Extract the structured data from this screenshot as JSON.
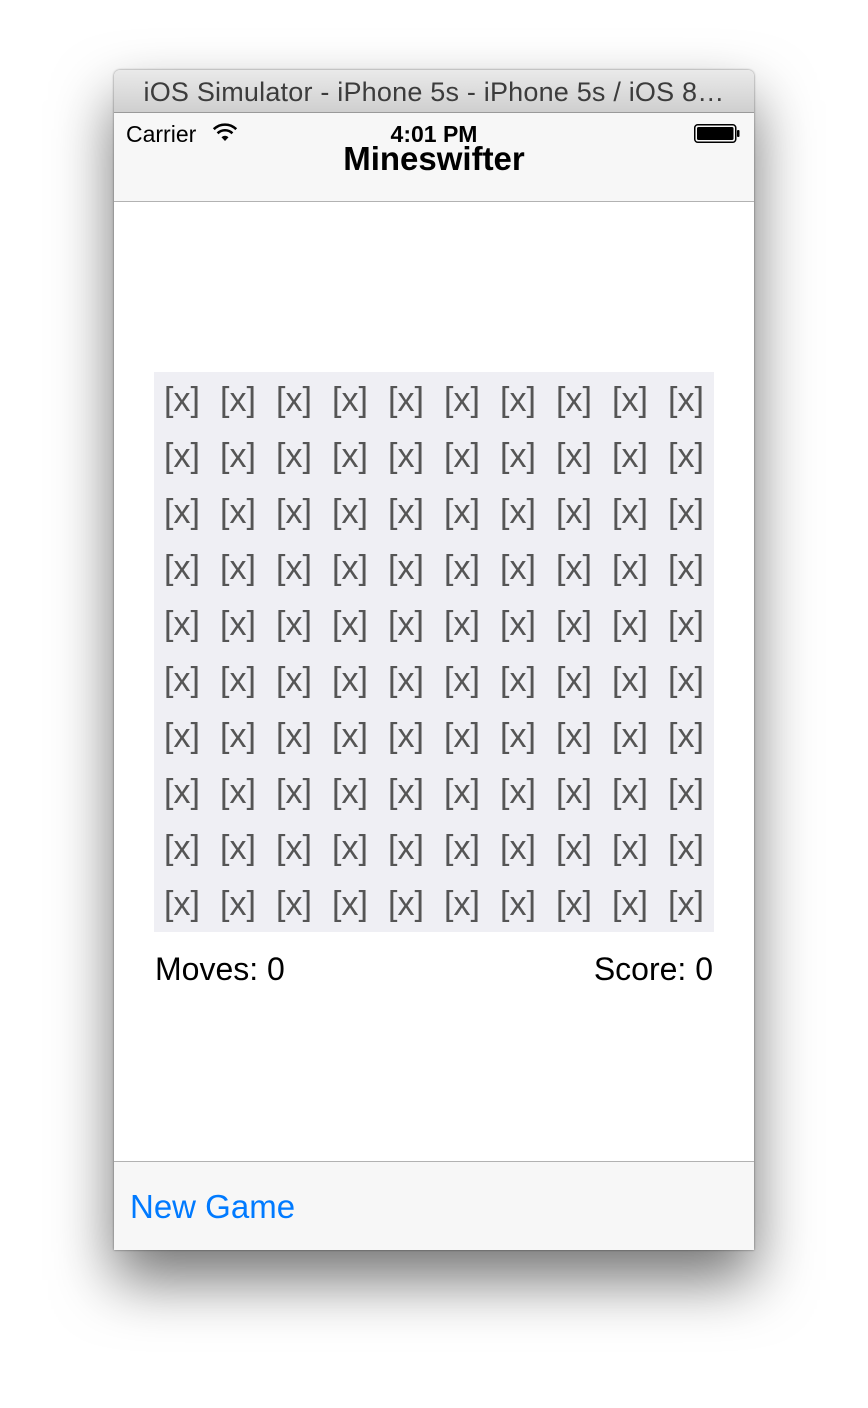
{
  "window": {
    "title": "iOS Simulator - iPhone 5s - iPhone 5s / iOS 8…"
  },
  "status_bar": {
    "carrier": "Carrier",
    "time": "4:01 PM",
    "wifi_icon": "wifi-icon",
    "battery_icon": "battery-icon"
  },
  "nav_bar": {
    "title": "Mineswifter"
  },
  "board": {
    "rows": 10,
    "columns": 10,
    "cells": [
      [
        "[x]",
        "[x]",
        "[x]",
        "[x]",
        "[x]",
        "[x]",
        "[x]",
        "[x]",
        "[x]",
        "[x]"
      ],
      [
        "[x]",
        "[x]",
        "[x]",
        "[x]",
        "[x]",
        "[x]",
        "[x]",
        "[x]",
        "[x]",
        "[x]"
      ],
      [
        "[x]",
        "[x]",
        "[x]",
        "[x]",
        "[x]",
        "[x]",
        "[x]",
        "[x]",
        "[x]",
        "[x]"
      ],
      [
        "[x]",
        "[x]",
        "[x]",
        "[x]",
        "[x]",
        "[x]",
        "[x]",
        "[x]",
        "[x]",
        "[x]"
      ],
      [
        "[x]",
        "[x]",
        "[x]",
        "[x]",
        "[x]",
        "[x]",
        "[x]",
        "[x]",
        "[x]",
        "[x]"
      ],
      [
        "[x]",
        "[x]",
        "[x]",
        "[x]",
        "[x]",
        "[x]",
        "[x]",
        "[x]",
        "[x]",
        "[x]"
      ],
      [
        "[x]",
        "[x]",
        "[x]",
        "[x]",
        "[x]",
        "[x]",
        "[x]",
        "[x]",
        "[x]",
        "[x]"
      ],
      [
        "[x]",
        "[x]",
        "[x]",
        "[x]",
        "[x]",
        "[x]",
        "[x]",
        "[x]",
        "[x]",
        "[x]"
      ],
      [
        "[x]",
        "[x]",
        "[x]",
        "[x]",
        "[x]",
        "[x]",
        "[x]",
        "[x]",
        "[x]",
        "[x]"
      ],
      [
        "[x]",
        "[x]",
        "[x]",
        "[x]",
        "[x]",
        "[x]",
        "[x]",
        "[x]",
        "[x]",
        "[x]"
      ]
    ]
  },
  "stats": {
    "moves": "Moves: 0",
    "score": "Score: 0"
  },
  "toolbar": {
    "new_game_label": "New Game"
  },
  "colors": {
    "accent": "#007aff",
    "board_background": "#efeff4",
    "cell_text": "#555555",
    "bar_background": "#f7f7f7"
  }
}
